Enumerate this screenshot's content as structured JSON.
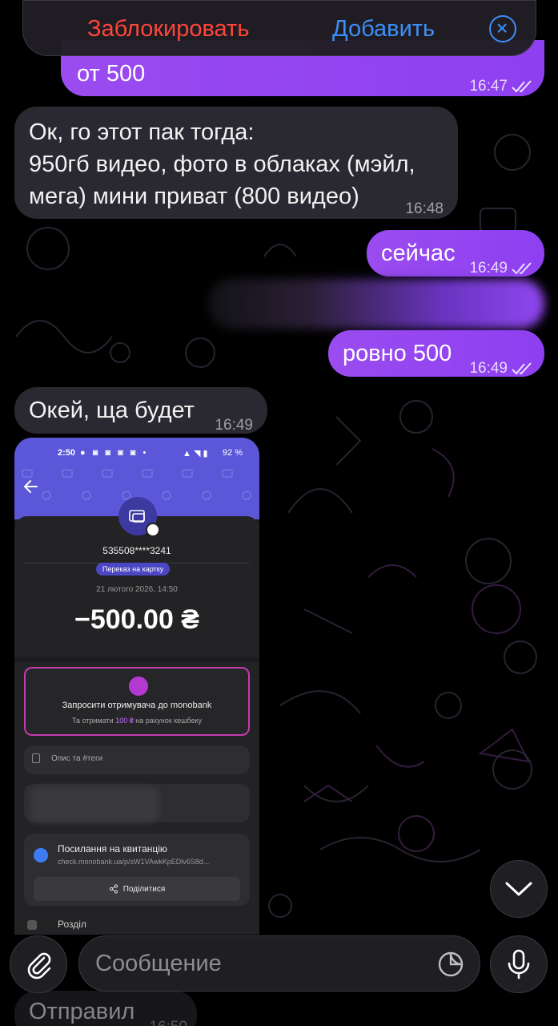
{
  "top_bar": {
    "block_label": "Заблокировать",
    "add_label": "Добавить",
    "colors": {
      "block": "#ff453a",
      "add": "#3d8ef7"
    }
  },
  "messages": [
    {
      "dir": "out",
      "text": "от 500",
      "time": "16:47"
    },
    {
      "dir": "in",
      "lines": [
        "Ок, го этот пак тогда:",
        "950гб видео, фото в облаках (мэйл,",
        "мега) мини приват (800 видео)"
      ],
      "time": "16:48"
    },
    {
      "dir": "out",
      "text": "сейчас",
      "time": "16:49"
    },
    {
      "dir": "out",
      "text": "ровно 500",
      "time": "16:49"
    },
    {
      "dir": "in",
      "text": "Окей, ща будет",
      "time": "16:49"
    },
    {
      "dir": "in",
      "text": "Отправил",
      "time": "16:50"
    }
  ],
  "receipt": {
    "status_time": "2:50",
    "battery": "92 %",
    "card_number": "535508****3241",
    "chip": "Переказ на картку",
    "date": "21 лютого 2026, 14:50",
    "amount": "−500.00 ₴",
    "promo_title": "Запросити отримувача до monobank",
    "promo_pre": "Та отримати",
    "promo_amount": "100 ₴",
    "promo_post": "на рахунок кешбеку",
    "desc_placeholder": "Опис та #теги",
    "receipt_link_title": "Посилання на квитанцію",
    "receipt_link_url": "check.monobank.ua/p/sW1VAwkKpEDlv6S8d...",
    "share_label": "Поділитися",
    "partial_label": "Розділ"
  },
  "composer": {
    "placeholder": "Сообщение"
  },
  "colors": {
    "outgoing": "#9a4cf0",
    "incoming": "#2a2830",
    "receipt_accent": "#5b57d8"
  }
}
